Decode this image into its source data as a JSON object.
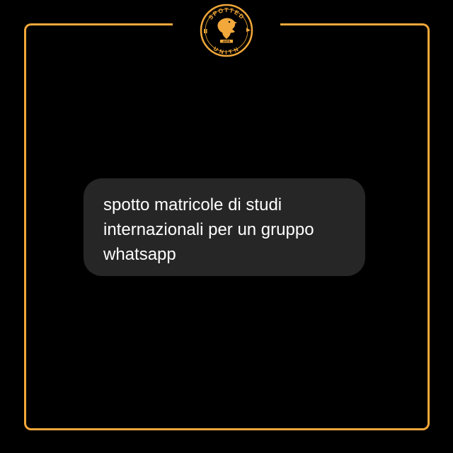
{
  "colors": {
    "background": "#000000",
    "frame": "#f2a83a",
    "bubble": "#262626",
    "text": "#ffffff"
  },
  "logo": {
    "name": "spotted-unitn-logo",
    "top_text": "SPOTTED",
    "bottom_text": "UNITN",
    "banner_text": "UNITN"
  },
  "message": {
    "text": "spotto matricole di studi internazionali per un gruppo whatsapp"
  }
}
